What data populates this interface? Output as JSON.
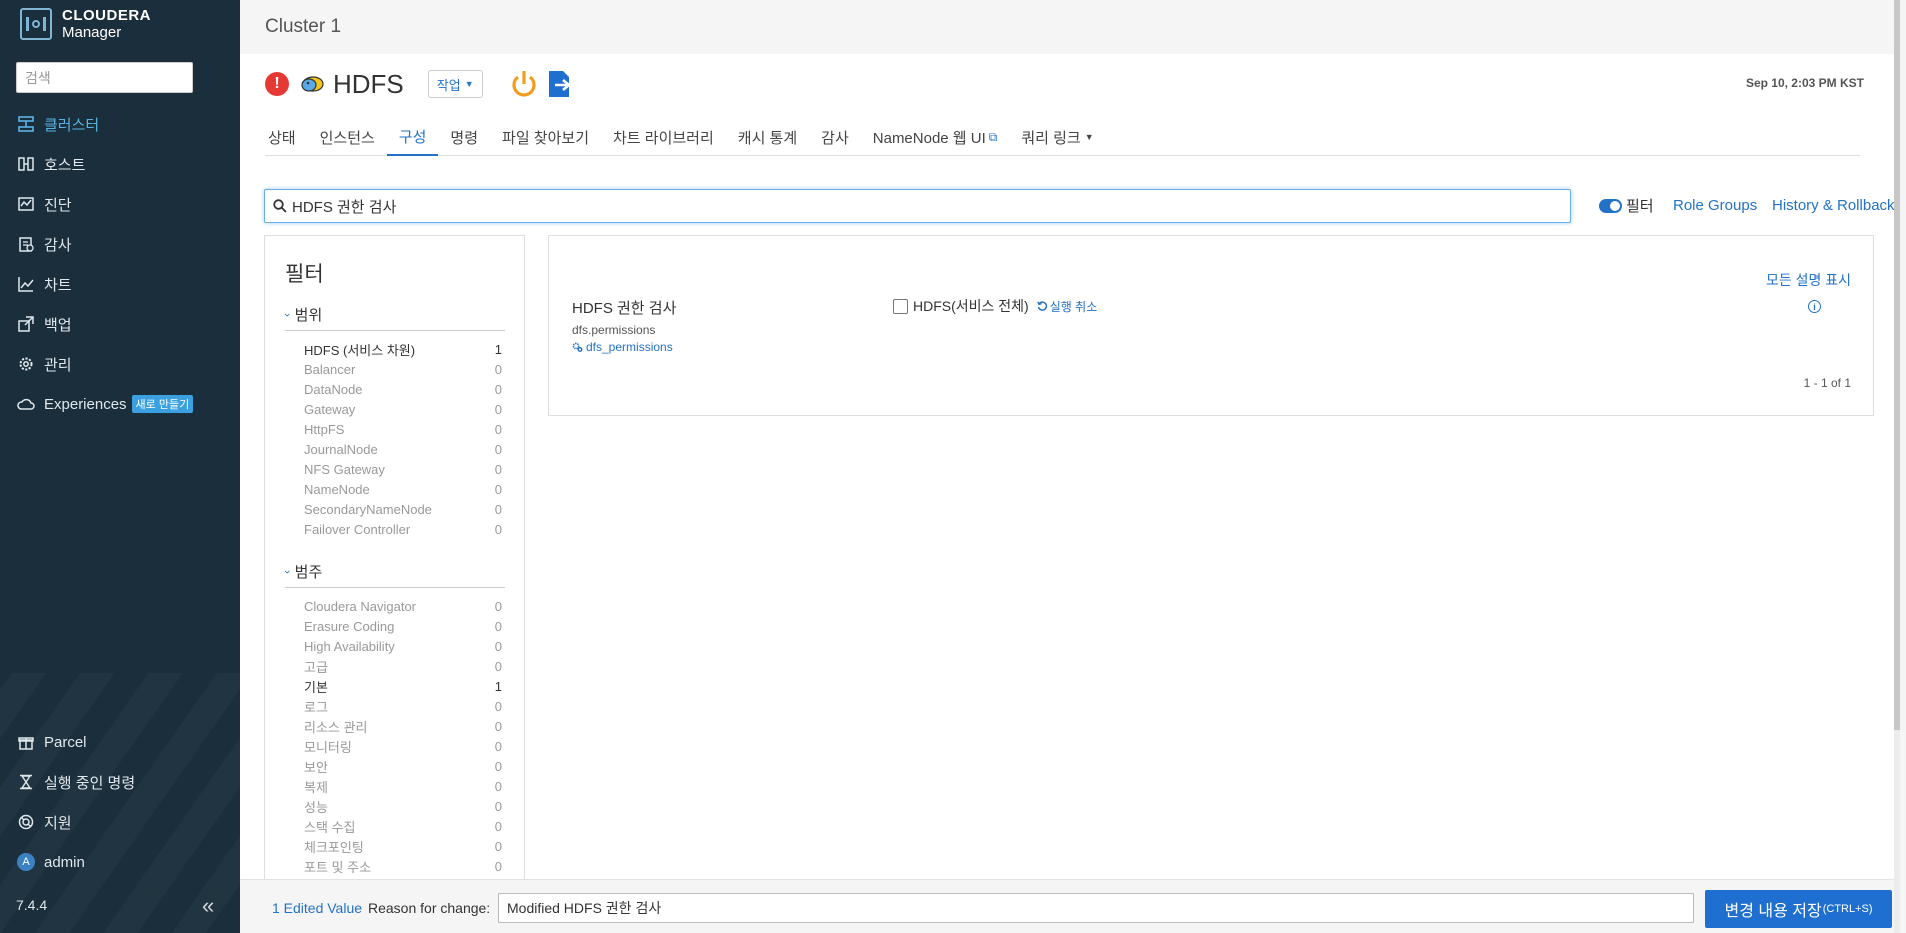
{
  "sidebar": {
    "logo_line1": "CLOUDERA",
    "logo_line2": "Manager",
    "search_placeholder": "검색",
    "items": [
      {
        "label": "클러스터",
        "icon": "cluster-icon"
      },
      {
        "label": "호스트",
        "icon": "hosts-icon"
      },
      {
        "label": "진단",
        "icon": "diagnostics-icon"
      },
      {
        "label": "감사",
        "icon": "audit-icon"
      },
      {
        "label": "차트",
        "icon": "chart-icon"
      },
      {
        "label": "백업",
        "icon": "backup-icon"
      },
      {
        "label": "관리",
        "icon": "gear-icon"
      },
      {
        "label": "Experiences",
        "icon": "cloud-icon",
        "badge": "새로 만들기"
      }
    ],
    "bottom_items": [
      {
        "label": "Parcel",
        "icon": "gift-icon"
      },
      {
        "label": "실행 중인 명령",
        "icon": "hourglass-icon"
      },
      {
        "label": "지원",
        "icon": "lifebuoy-icon"
      },
      {
        "label": "admin",
        "icon": "avatar-icon",
        "avatar_letter": "A"
      }
    ],
    "version": "7.4.4"
  },
  "header": {
    "cluster": "Cluster 1",
    "service": "HDFS",
    "actions_label": "작업",
    "timestamp": "Sep 10, 2:03 PM KST"
  },
  "tabs": [
    "상태",
    "인스턴스",
    "구성",
    "명령",
    "파일 찾아보기",
    "차트 라이브러리",
    "캐시 통계",
    "감사",
    "NameNode 웹 UI",
    "쿼리 링크"
  ],
  "search": {
    "value": "HDFS 권한 검사",
    "filter_label": "필터",
    "role_groups": "Role Groups",
    "history": "History & Rollback"
  },
  "filters": {
    "title": "필터",
    "scope_label": "범위",
    "scope": [
      {
        "name": "HDFS (서비스 차원)",
        "count": "1"
      },
      {
        "name": "Balancer",
        "count": "0"
      },
      {
        "name": "DataNode",
        "count": "0"
      },
      {
        "name": "Gateway",
        "count": "0"
      },
      {
        "name": "HttpFS",
        "count": "0"
      },
      {
        "name": "JournalNode",
        "count": "0"
      },
      {
        "name": "NFS Gateway",
        "count": "0"
      },
      {
        "name": "NameNode",
        "count": "0"
      },
      {
        "name": "SecondaryNameNode",
        "count": "0"
      },
      {
        "name": "Failover Controller",
        "count": "0"
      }
    ],
    "category_label": "범주",
    "category": [
      {
        "name": "Cloudera Navigator",
        "count": "0"
      },
      {
        "name": "Erasure Coding",
        "count": "0"
      },
      {
        "name": "High Availability",
        "count": "0"
      },
      {
        "name": "고급",
        "count": "0"
      },
      {
        "name": "기본",
        "count": "1"
      },
      {
        "name": "로그",
        "count": "0"
      },
      {
        "name": "리소스 관리",
        "count": "0"
      },
      {
        "name": "모니터링",
        "count": "0"
      },
      {
        "name": "보안",
        "count": "0"
      },
      {
        "name": "복제",
        "count": "0"
      },
      {
        "name": "성능",
        "count": "0"
      },
      {
        "name": "스택 수집",
        "count": "0"
      },
      {
        "name": "체크포인팅",
        "count": "0"
      },
      {
        "name": "포트 및 주소",
        "count": "0"
      }
    ]
  },
  "result": {
    "show_all": "모든 설명 표시",
    "property_name": "HDFS 권한 검사",
    "property_key": "dfs.permissions",
    "property_link": "dfs_permissions",
    "value_label": "HDFS(서비스 전체)",
    "undo_label": "실행 취소",
    "pager": "1 - 1 of 1"
  },
  "footer": {
    "edited": "1 Edited Value",
    "reason_label": "Reason for change:",
    "reason_value": "Modified HDFS 권한 검사",
    "save_label": "변경 내용 저장",
    "save_shortcut": "(CTRL+S)"
  },
  "colors": {
    "sidebar_bg": "#1a2e3b",
    "accent": "#2372c7",
    "save_button": "#1f6fd0",
    "error": "#e53935"
  }
}
